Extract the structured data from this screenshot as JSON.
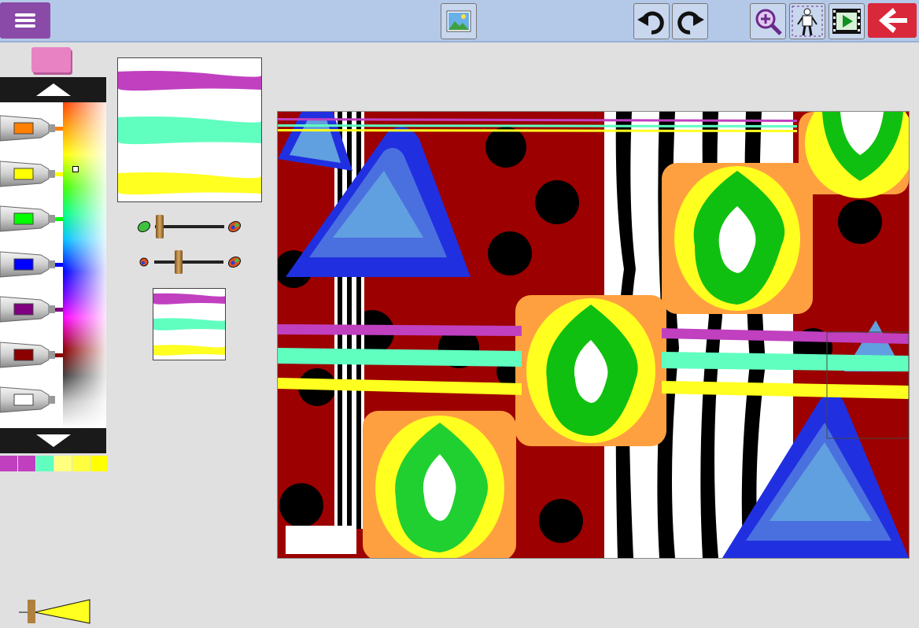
{
  "toolbar": {
    "menu": "menu-icon",
    "image": "image-icon",
    "undo": "undo-icon",
    "redo": "redo-icon",
    "zoom": "zoom-in-icon",
    "stamp": "figure-icon",
    "movie": "film-play-icon",
    "back": "back-arrow-icon"
  },
  "colors": {
    "topbar": "#b4c9e8",
    "menu": "#8a4aa8",
    "back": "#d9283a",
    "canvas_red": "#9c0000",
    "purple": "#c040c0",
    "mint": "#60ffc0",
    "yellow": "#ffff20",
    "orange": "#ffa040",
    "green": "#10c010",
    "blue": "#2030e0",
    "light_blue": "#60a0e0"
  },
  "palette": {
    "tubes": [
      "#ff8000",
      "#ffff00",
      "#00ff00",
      "#0000ff",
      "#800080",
      "#8b0000",
      "#ffffff"
    ],
    "recent": [
      "#c040c0",
      "#c040c0",
      "#60ffc0",
      "#ffff80",
      "#ffff40",
      "#ffff00"
    ]
  },
  "sliders": {
    "brush_size_level": 0.15,
    "brush_opacity_level": 0.4,
    "size_indicator_level": 0.15
  }
}
